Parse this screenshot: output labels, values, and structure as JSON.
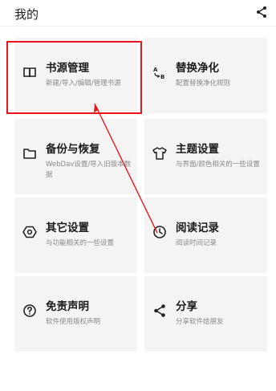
{
  "header": {
    "title": "我的",
    "share_icon": "share-icon"
  },
  "cards": [
    {
      "key": "book-source",
      "name": "书源管理",
      "desc": "新建/导入/编辑/管理书源",
      "icon": "book-open-icon"
    },
    {
      "key": "replace",
      "name": "替换净化",
      "desc": "配置替换净化规则",
      "icon": "replace-ab-icon"
    },
    {
      "key": "backup",
      "name": "备份与恢复",
      "desc": "WebDav设置/导入旧版本数据",
      "icon": "folder-icon"
    },
    {
      "key": "theme",
      "name": "主题设置",
      "desc": "与界面/颜色相关的一些设置",
      "icon": "tshirt-icon"
    },
    {
      "key": "other",
      "name": "其它设置",
      "desc": "与功能相关的一些设置",
      "icon": "hex-gear-icon"
    },
    {
      "key": "history",
      "name": "阅读记录",
      "desc": "阅读时间记录",
      "icon": "clock-icon"
    },
    {
      "key": "disclaimer",
      "name": "免责声明",
      "desc": "软件使用版权声明",
      "icon": "question-icon"
    },
    {
      "key": "share",
      "name": "分享",
      "desc": "分享软件给朋友",
      "icon": "share-icon"
    }
  ],
  "colors": {
    "annotation": "#e8161a",
    "card_bg": "#f4f4f4"
  }
}
